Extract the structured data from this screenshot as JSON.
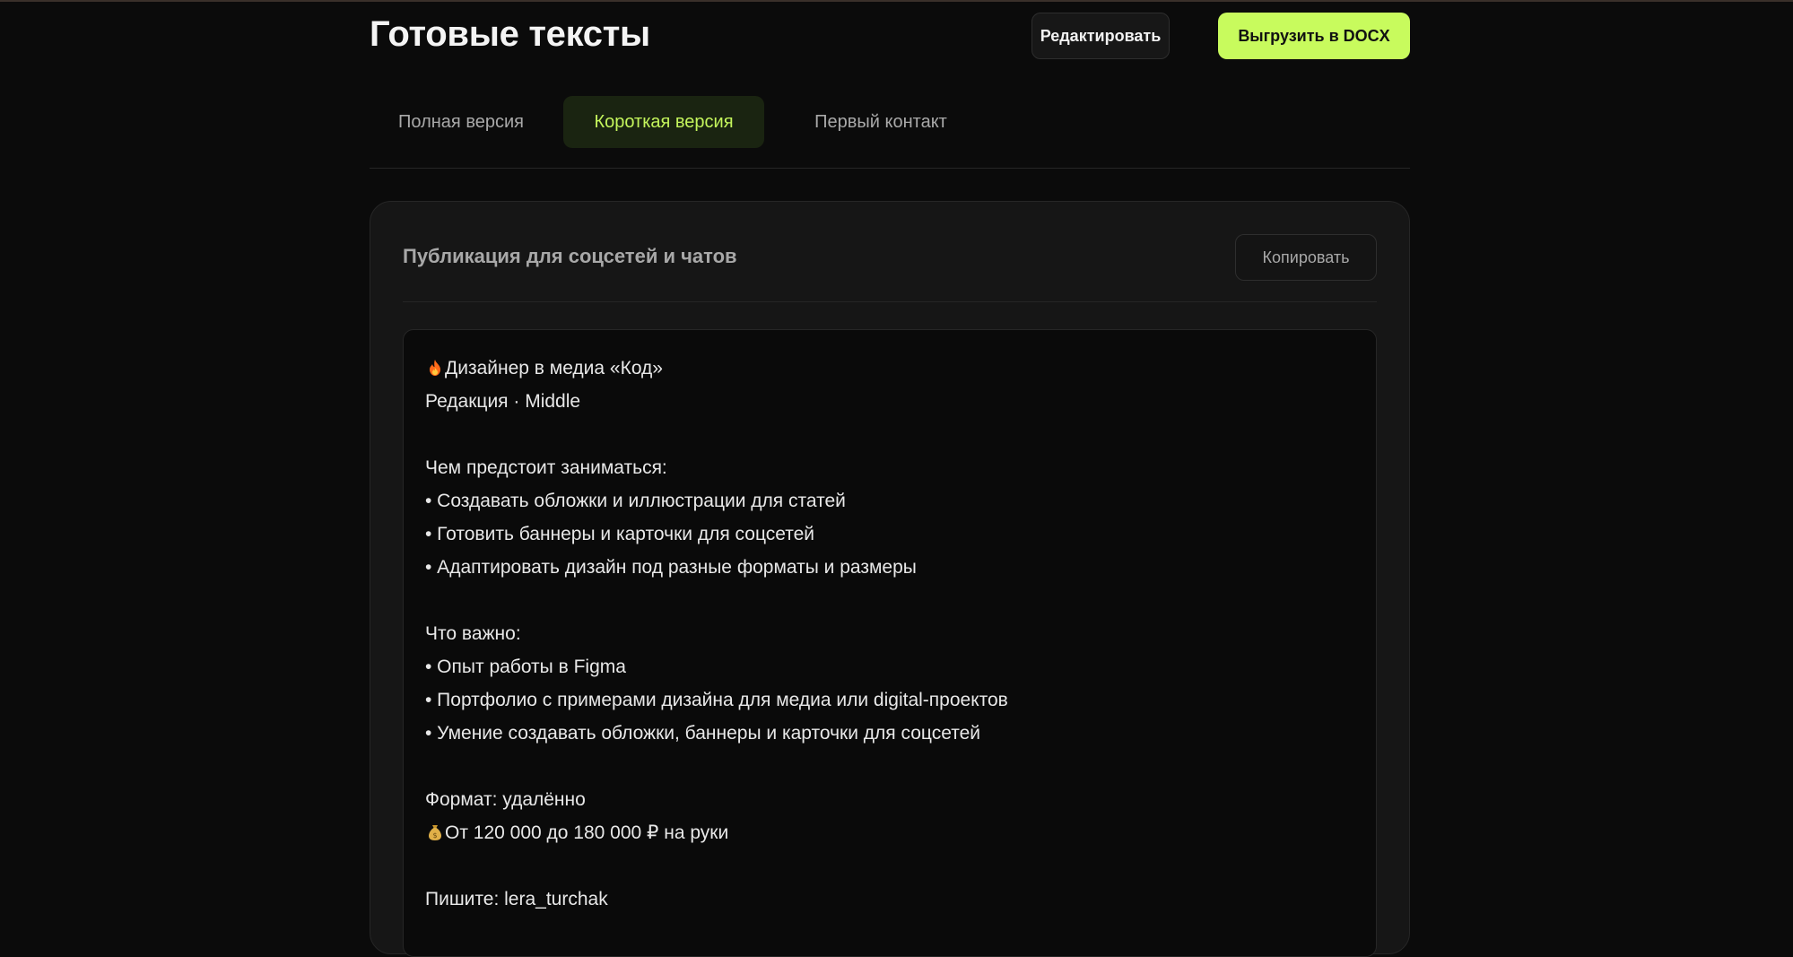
{
  "header": {
    "title": "Готовые тексты",
    "edit_label": "Редактировать",
    "export_label": "Выгрузить в DOCX"
  },
  "tabs": [
    {
      "label": "Полная версия",
      "active": false
    },
    {
      "label": "Короткая версия",
      "active": true
    },
    {
      "label": "Первый контакт",
      "active": false
    }
  ],
  "card": {
    "title": "Публикация для соцсетей и чатов",
    "copy_label": "Копировать"
  },
  "post": {
    "headline_icon": "fire-icon",
    "headline": "Дизайнер в медиа «Код»",
    "subline": "Редакция · Middle",
    "tasks_title": "Чем предстоит заниматься:",
    "tasks": [
      "• Создавать обложки и иллюстрации для статей",
      "• Готовить баннеры и карточки для соцсетей",
      "• Адаптировать дизайн под разные форматы и размеры"
    ],
    "req_title": "Что важно:",
    "requirements": [
      "• Опыт работы в Figma",
      "• Портфолио с примерами дизайна для медиа или digital-проектов",
      "• Умение создавать обложки, баннеры и карточки для соцсетей"
    ],
    "format": "Формат: удалённо",
    "salary_icon": "money-bag-icon",
    "salary": "От 120 000 до 180 000 ₽ на руки",
    "contact": "Пишите: lera_turchak"
  },
  "colors": {
    "background": "#0b0b0b",
    "accent": "#c8fb5d",
    "active_tab_bg": "#1a2411",
    "active_tab_text": "#c4f55c"
  }
}
